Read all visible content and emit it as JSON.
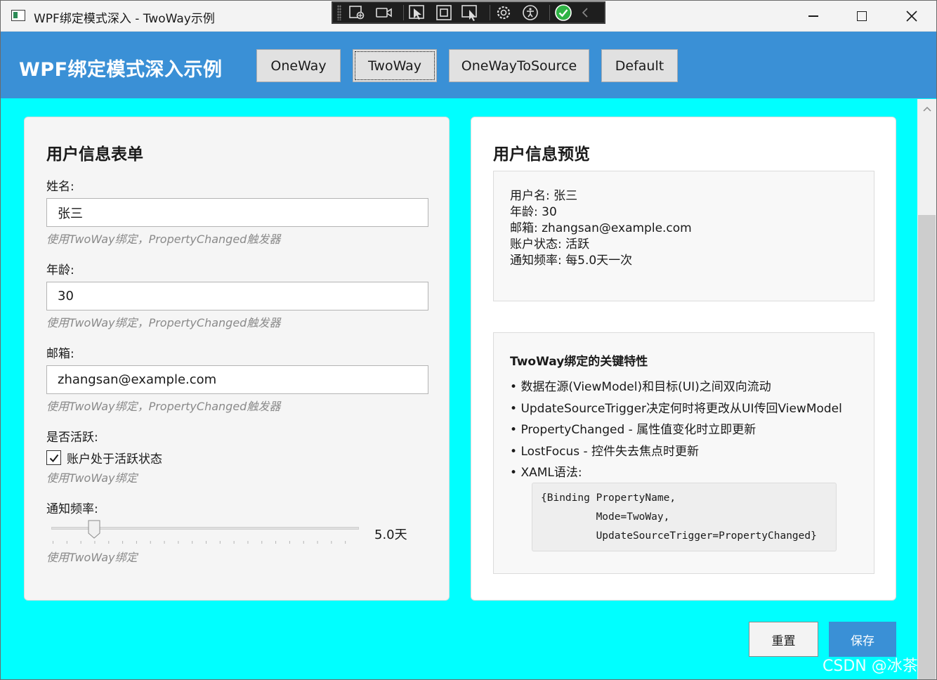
{
  "window": {
    "title": "WPF绑定模式深入 - TwoWay示例"
  },
  "debug_toolbar": {
    "icons": [
      "select-element-icon",
      "record-icon",
      "pointer-icon",
      "frame-icon",
      "inspect-icon",
      "settings-icon",
      "accessibility-icon",
      "check-circle-icon",
      "collapse-icon"
    ]
  },
  "header": {
    "title": "WPF绑定模式深入示例",
    "modes": [
      "OneWay",
      "TwoWay",
      "OneWayToSource",
      "Default"
    ],
    "focused_mode": "TwoWay"
  },
  "form": {
    "title": "用户信息表单",
    "name_label": "姓名:",
    "name_value": "张三",
    "name_hint": "使用TwoWay绑定，PropertyChanged触发器",
    "age_label": "年龄:",
    "age_value": "30",
    "age_hint": "使用TwoWay绑定，PropertyChanged触发器",
    "email_label": "邮箱:",
    "email_value": "zhangsan@example.com",
    "email_hint": "使用TwoWay绑定，PropertyChanged触发器",
    "active_label": "是否活跃:",
    "active_checkbox_label": "账户处于活跃状态",
    "active_checked": true,
    "active_hint": "使用TwoWay绑定",
    "frequency_label": "通知频率:",
    "frequency_value_text": "5.0天",
    "frequency_level": 0.14,
    "frequency_hint": "使用TwoWay绑定"
  },
  "preview": {
    "title": "用户信息预览",
    "lines": [
      "用户名: 张三",
      "年龄: 30",
      "邮箱: zhangsan@example.com",
      "账户状态: 活跃",
      "通知频率: 每5.0天一次"
    ],
    "feature_title": "TwoWay绑定的关键特性",
    "features": [
      "数据在源(ViewModel)和目标(UI)之间双向流动",
      "UpdateSourceTrigger决定何时将更改从UI传回ViewModel",
      "PropertyChanged - 属性值变化时立即更新",
      "LostFocus - 控件失去焦点时更新",
      "XAML语法:"
    ],
    "code_lines": [
      "{Binding PropertyName,",
      "         Mode=TwoWay,",
      "         UpdateSourceTrigger=PropertyChanged}"
    ]
  },
  "actions": {
    "reset_label": "重置",
    "save_label": "保存"
  },
  "watermark": "CSDN @冰茶",
  "colors": {
    "accent": "#3a90d6",
    "background": "#00ffff",
    "card": "#f5f5f5"
  }
}
